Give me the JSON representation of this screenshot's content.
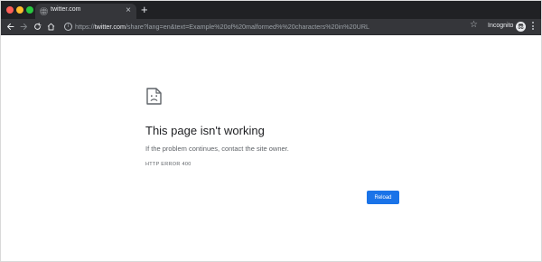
{
  "browser": {
    "tab": {
      "title": "twitter.com",
      "favicon": "globe-icon"
    },
    "toolbar": {
      "url_scheme": "https://",
      "url_host": "twitter.com",
      "url_path": "/share?lang=en&text=Example%20of%20malformed%%20characters%20in%20URL",
      "profile_label": "Incognito"
    },
    "colors": {
      "tabstrip": "#202124",
      "toolbar": "#35363a",
      "close_dot": "#ff5f57",
      "minimize_dot": "#febc2e",
      "zoom_dot": "#28c840"
    }
  },
  "page": {
    "icon": "sad-page-icon",
    "heading": "This page isn't working",
    "message": "If the problem continues, contact the site owner.",
    "error_code": "HTTP ERROR 400",
    "reload_button": "Reload",
    "colors": {
      "accent": "#1a73e8",
      "heading": "#202124",
      "body_text": "#5f6368"
    }
  }
}
